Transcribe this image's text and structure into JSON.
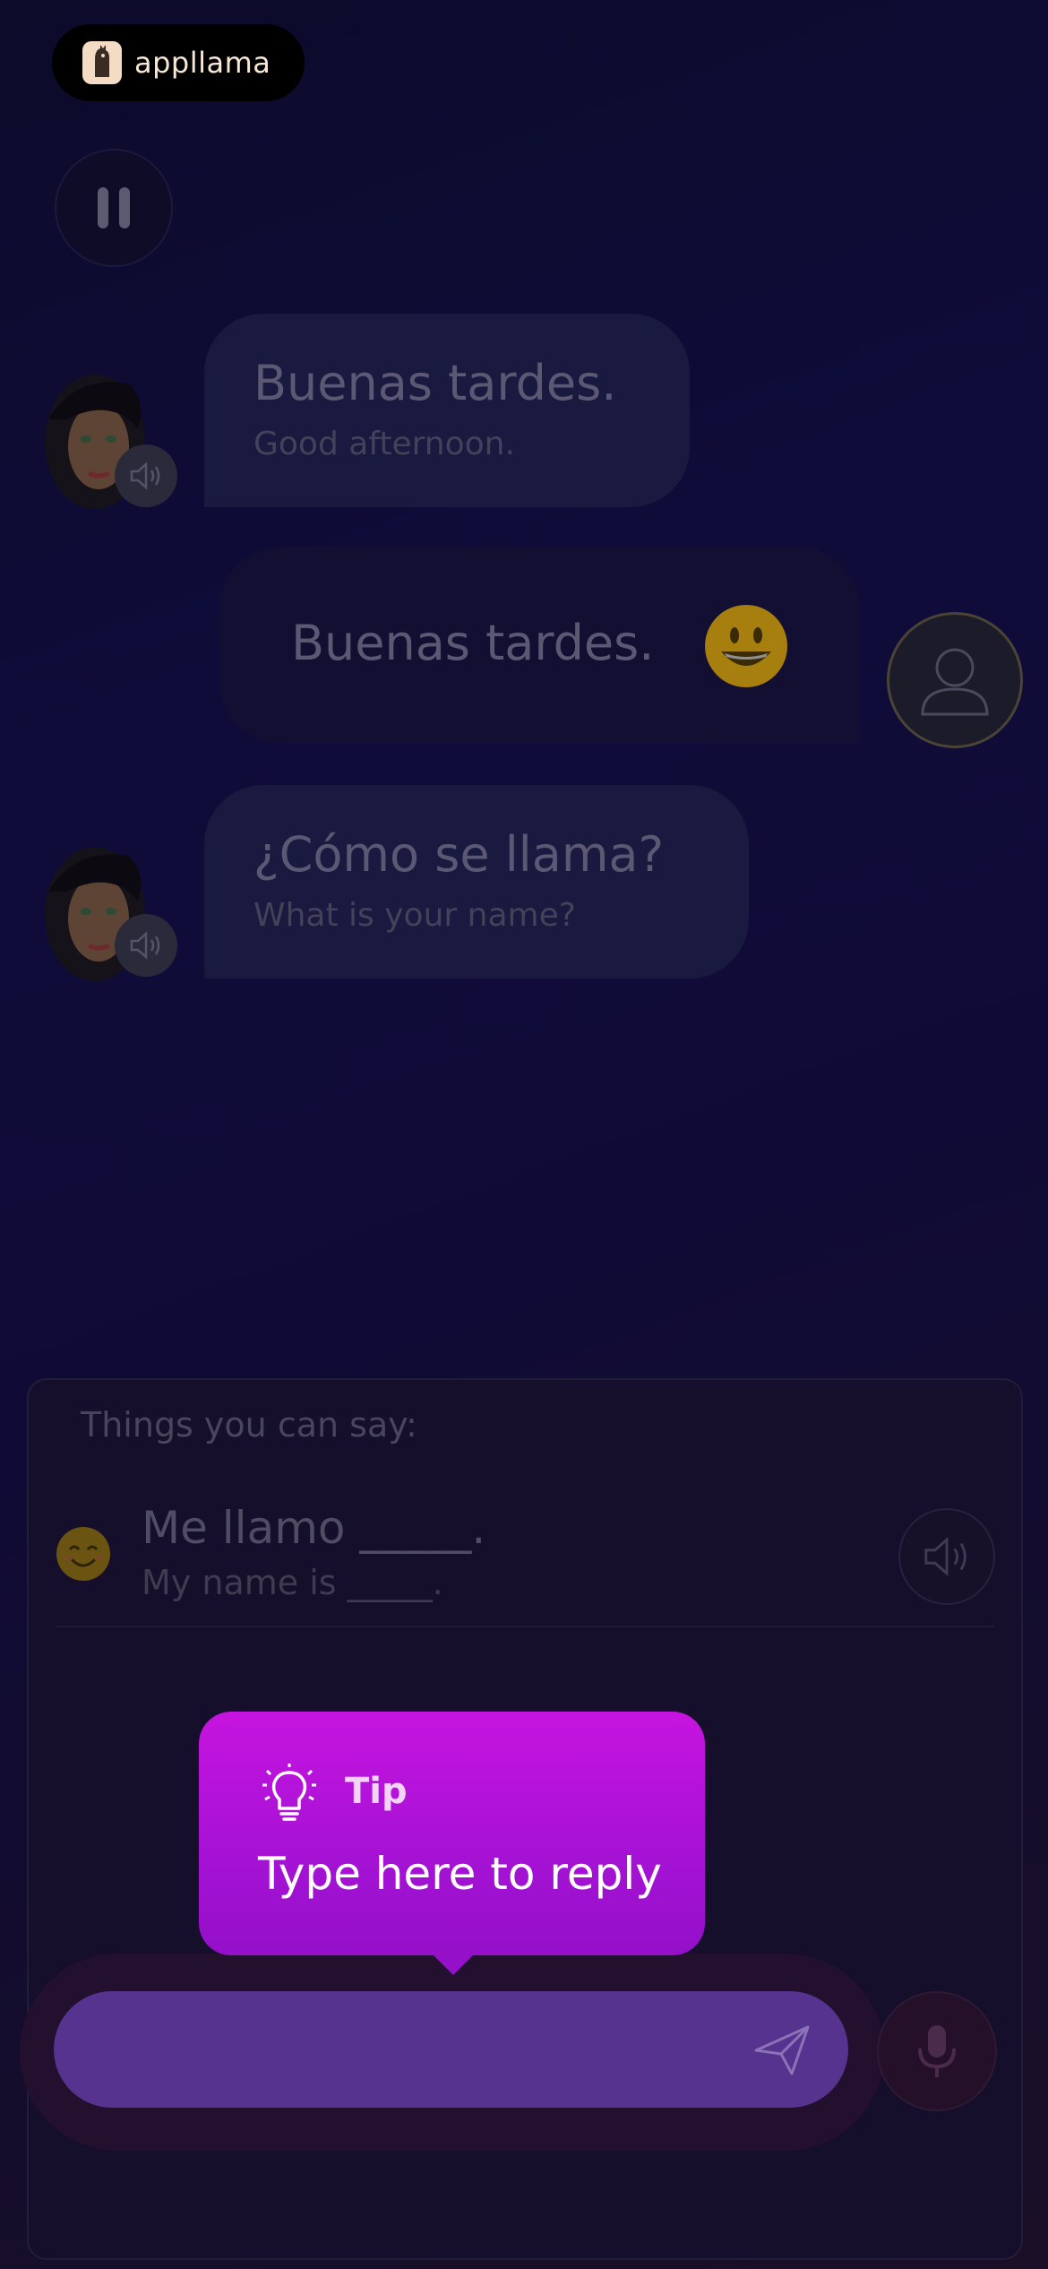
{
  "app": {
    "logo_text": "appllama"
  },
  "controls": {
    "pause_icon": "pause-icon"
  },
  "conversation": [
    {
      "speaker": "tutor",
      "main": "Buenas tardes.",
      "sub": "Good afternoon."
    },
    {
      "speaker": "user",
      "main": "Buenas tardes.",
      "emoji": "grinning-face"
    },
    {
      "speaker": "tutor",
      "main": "¿Cómo se llama?",
      "sub": "What is your name?"
    }
  ],
  "suggestions": {
    "title": "Things you can say:",
    "items": [
      {
        "main": "Me llamo _____.",
        "sub": "My name is _____.",
        "emoji": "smiling-face"
      }
    ]
  },
  "tip": {
    "label": "Tip",
    "text": "Type here to reply"
  },
  "input": {
    "value": "",
    "placeholder": ""
  },
  "colors": {
    "tip_start": "#c614df",
    "tip_end": "#9410c9",
    "input_bg": "#56338f",
    "background": "#0f0c3a"
  }
}
